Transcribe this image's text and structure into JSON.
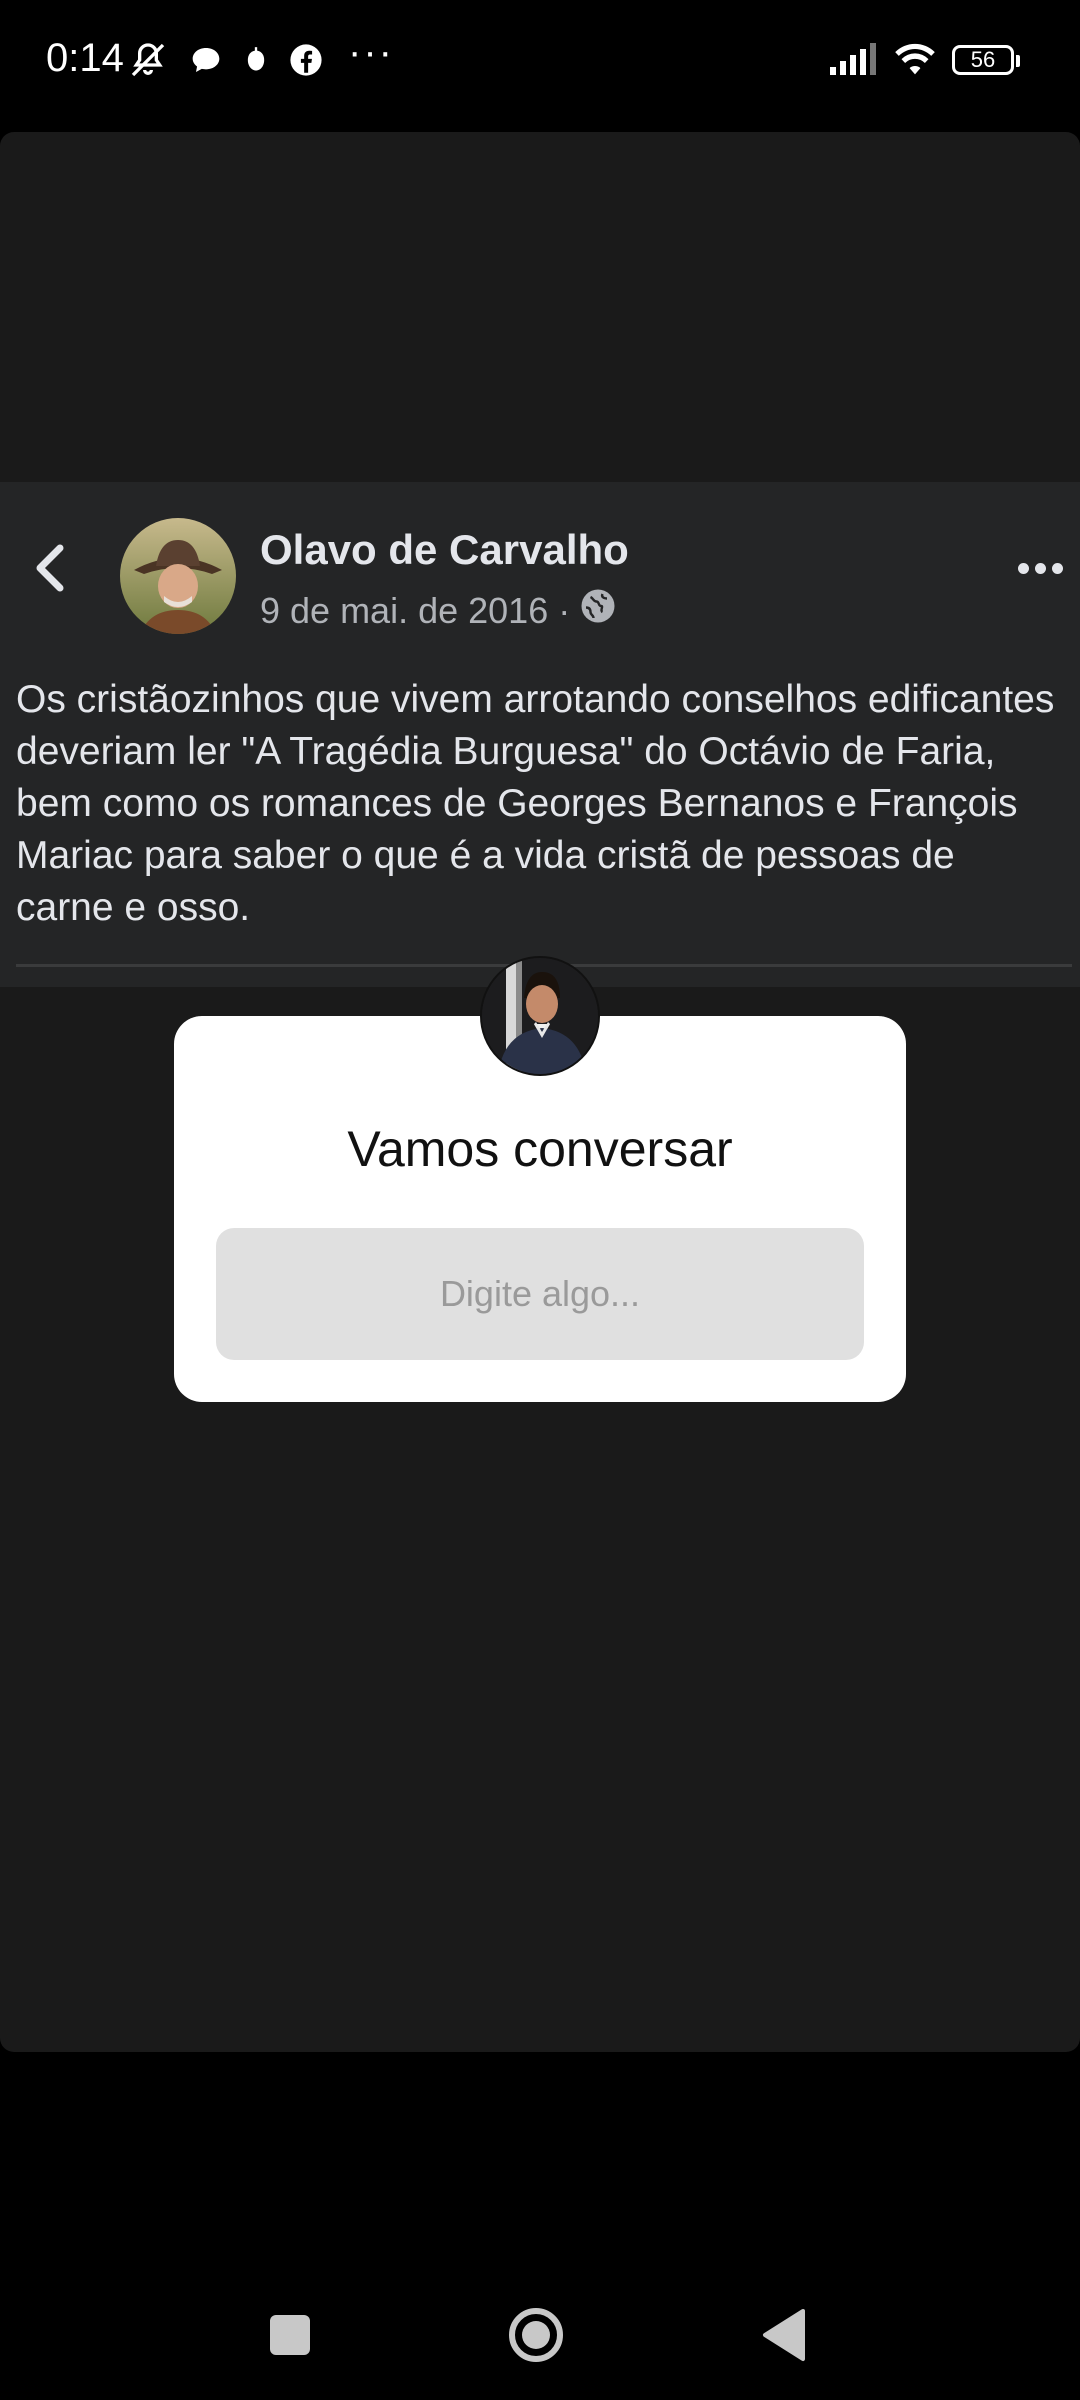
{
  "status_bar": {
    "time": "0:14",
    "battery": "56",
    "icons": [
      "mute-icon",
      "message-bubble-icon",
      "notification-icon",
      "facebook-icon",
      "signal-icon",
      "wifi-icon"
    ],
    "more": "···"
  },
  "post": {
    "author": "Olavo de Carvalho",
    "date": "9 de mai. de 2016",
    "separator": "·",
    "privacy_icon": "globe-icon",
    "text": "Os cristãozinhos que vivem arrotando conselhos edificantes deveriam ler \"A Tragédia Burguesa\" do Octávio de Faria, bem como os romances de Georges Bernanos e François Mariac para saber o que é a vida cristã de pessoas de carne e osso."
  },
  "chat_popup": {
    "title": "Vamos conversar",
    "input_placeholder": "Digite algo...",
    "input_value": ""
  },
  "nav_bar": {
    "buttons": [
      "recents-icon",
      "home-icon",
      "back-icon"
    ]
  },
  "colors": {
    "panel_bg": "#1a1a1a",
    "post_bg": "#242526",
    "text_primary": "#e4e6eb",
    "text_secondary": "#b0b3b8",
    "popup_bg": "#ffffff",
    "input_bg": "#e0e0e0"
  }
}
